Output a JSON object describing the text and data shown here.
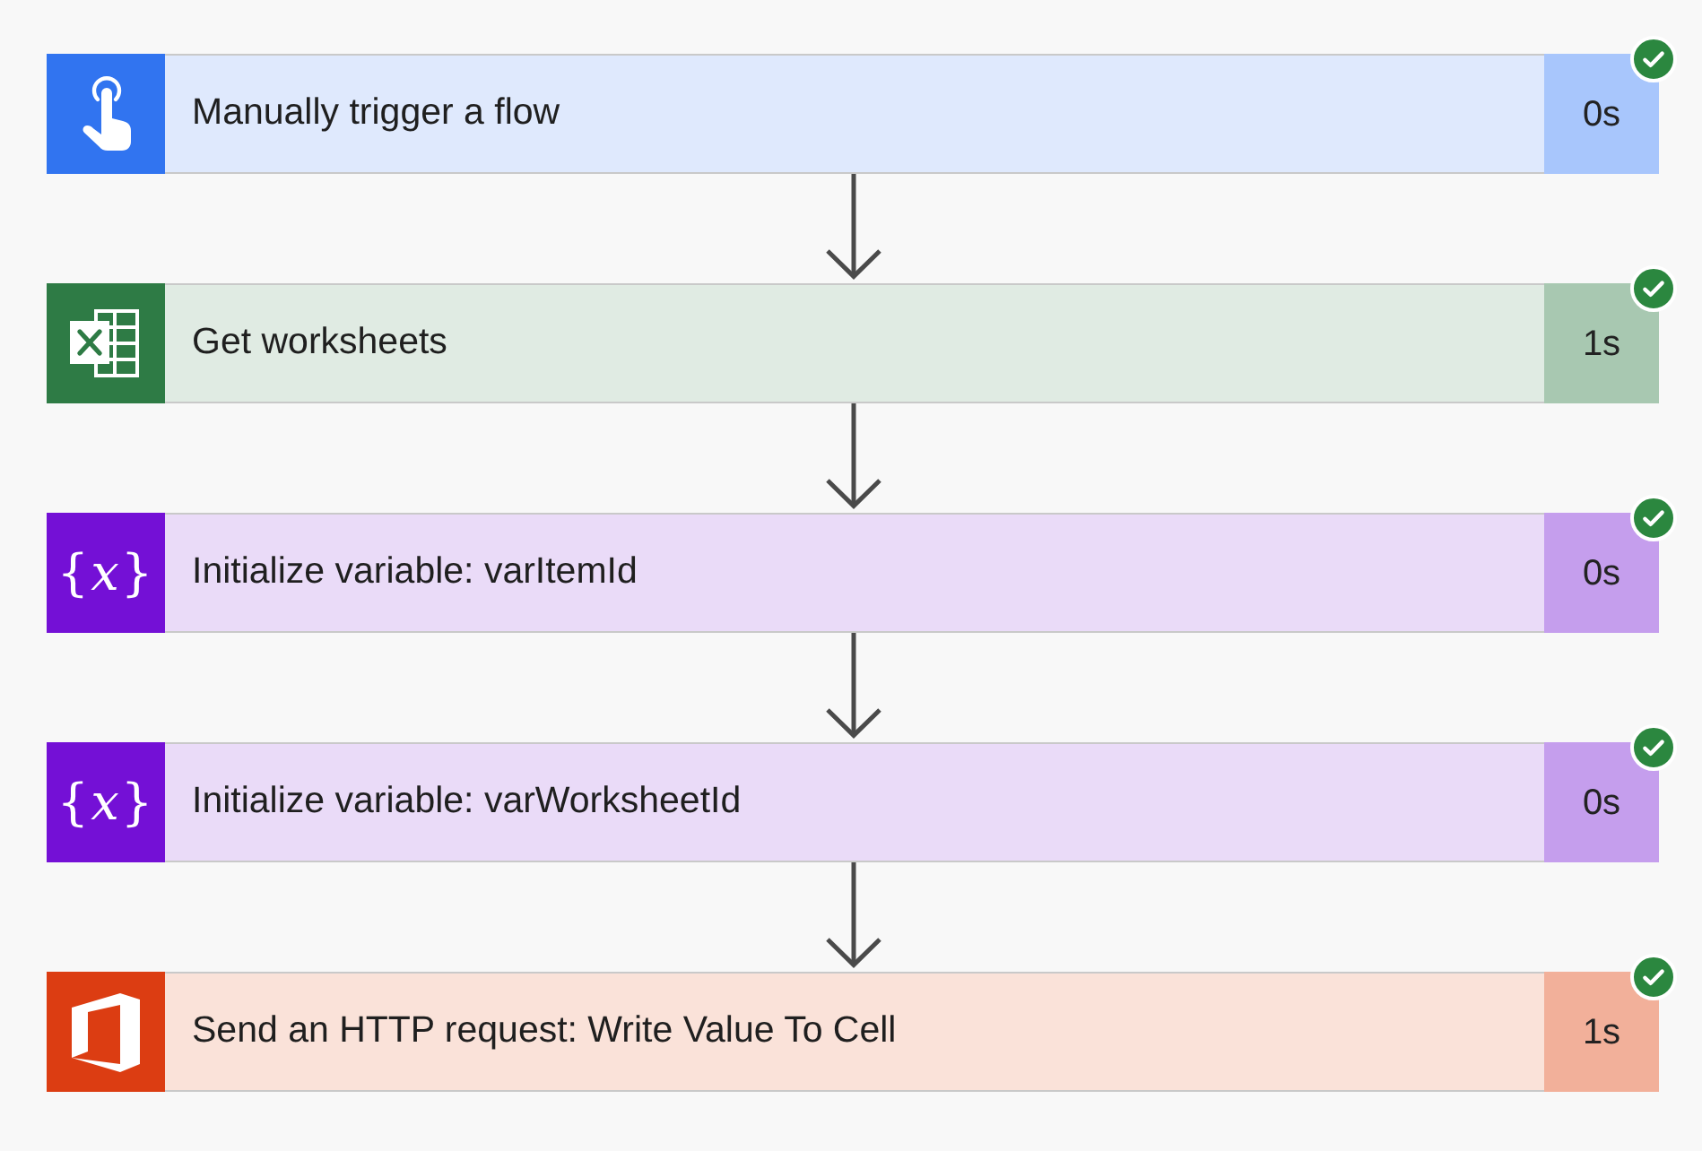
{
  "steps": [
    {
      "kind": "manual_trigger",
      "title": "Manually trigger a flow",
      "duration": "0s",
      "succeeded": true
    },
    {
      "kind": "excel",
      "title": "Get worksheets",
      "duration": "1s",
      "succeeded": true
    },
    {
      "kind": "variable",
      "icon_text": "{*x*}",
      "title": "Initialize variable: varItemId",
      "duration": "0s",
      "succeeded": true
    },
    {
      "kind": "variable",
      "icon_text": "{*x*}",
      "title": "Initialize variable: varWorksheetId",
      "duration": "0s",
      "succeeded": true
    },
    {
      "kind": "office",
      "title": "Send an HTTP request: Write Value To Cell",
      "duration": "1s",
      "succeeded": true
    }
  ]
}
